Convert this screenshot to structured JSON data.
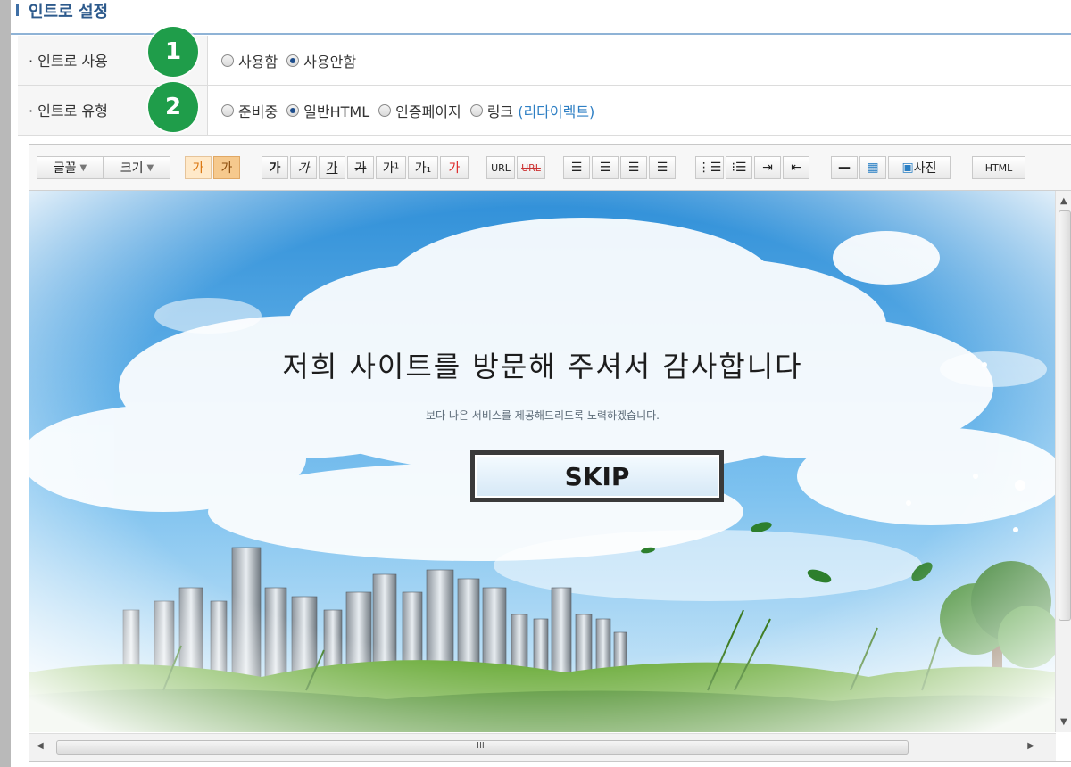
{
  "section": {
    "title": "인트로 설정"
  },
  "rows": [
    {
      "label": "· 인트로 사용",
      "badge": "1",
      "options": [
        {
          "label": "사용함",
          "checked": false
        },
        {
          "label": "사용안함",
          "checked": true
        }
      ]
    },
    {
      "label": "· 인트로 유형",
      "badge": "2",
      "options": [
        {
          "label": "준비중",
          "checked": false
        },
        {
          "label": "일반HTML",
          "checked": true
        },
        {
          "label": "인증페이지",
          "checked": false
        },
        {
          "label": "링크",
          "checked": false,
          "suffix": "(리다이렉트)"
        }
      ]
    }
  ],
  "toolbar": {
    "font": "글꼴",
    "size": "크기",
    "text_color": "가",
    "bg_color": "가",
    "bold": "가",
    "italic": "가",
    "underline": "가",
    "strike": "가",
    "superscript": "가¹",
    "subscript": "가₁",
    "clear": "가",
    "url": "URL",
    "unlink": "URL",
    "photo": "사진",
    "html": "HTML"
  },
  "intro": {
    "headline": "저희 사이트를 방문해 주셔서 감사합니다",
    "subline": "보다 나은 서비스를 제공해드리도록 노력하겠습니다.",
    "skip": "SKIP"
  },
  "scrollbar": {
    "grip": "III"
  },
  "colors": {
    "badge": "#1f9d4a",
    "accent": "#2d5a8c",
    "link": "#2e7fc4",
    "sky": "#4fa3e0"
  }
}
